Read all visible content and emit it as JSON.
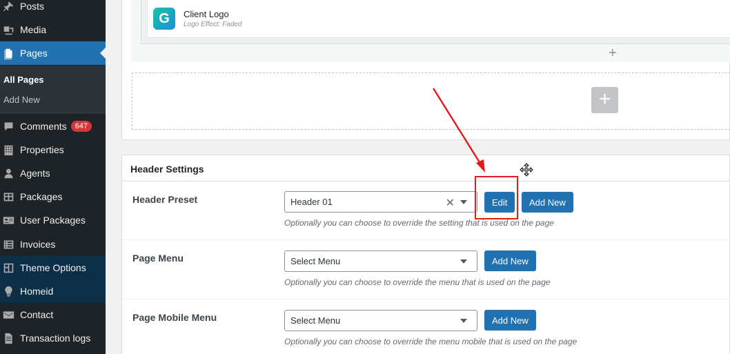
{
  "sidebar": {
    "items": [
      {
        "label": "Posts",
        "icon": "pin-icon"
      },
      {
        "label": "Media",
        "icon": "media-icon"
      },
      {
        "label": "Pages",
        "icon": "pages-icon"
      },
      {
        "label": "Comments",
        "icon": "comments-icon",
        "badge": "647"
      },
      {
        "label": "Properties",
        "icon": "building-icon"
      },
      {
        "label": "Agents",
        "icon": "person-icon"
      },
      {
        "label": "Packages",
        "icon": "table-icon"
      },
      {
        "label": "User Packages",
        "icon": "id-card-icon"
      },
      {
        "label": "Invoices",
        "icon": "list-icon"
      },
      {
        "label": "Theme Options",
        "icon": "layout-icon"
      },
      {
        "label": "Homeid",
        "icon": "lightbulb-icon"
      },
      {
        "label": "Contact",
        "icon": "envelope-icon"
      },
      {
        "label": "Transaction logs",
        "icon": "document-icon"
      }
    ],
    "submenu": {
      "all_pages": "All Pages",
      "add_new": "Add New"
    }
  },
  "builder": {
    "element_title": "Client Logo",
    "element_subtitle": "Logo Effect: Faded",
    "logo_letter": "G",
    "add_element": "+",
    "add_row": "+"
  },
  "header_settings": {
    "title": "Header Settings",
    "rows": [
      {
        "label": "Header Preset",
        "select_value": "Header 01",
        "clear_glyph": "✕",
        "buttons": [
          "Edit",
          "Add New"
        ],
        "hint": "Optionally you can choose to override the setting that is used on the page"
      },
      {
        "label": "Page Menu",
        "select_value": "Select Menu",
        "buttons": [
          "Add New"
        ],
        "hint": "Optionally you can choose to override the menu that is used on the page"
      },
      {
        "label": "Page Mobile Menu",
        "select_value": "Select Menu",
        "buttons": [
          "Add New"
        ],
        "hint": "Optionally you can choose to override the menu mobile that is used on the page"
      }
    ]
  },
  "colors": {
    "sidebar_bg": "#1d2327",
    "accent": "#2271b1",
    "annotation": "#e41b17",
    "badge": "#d63638"
  }
}
